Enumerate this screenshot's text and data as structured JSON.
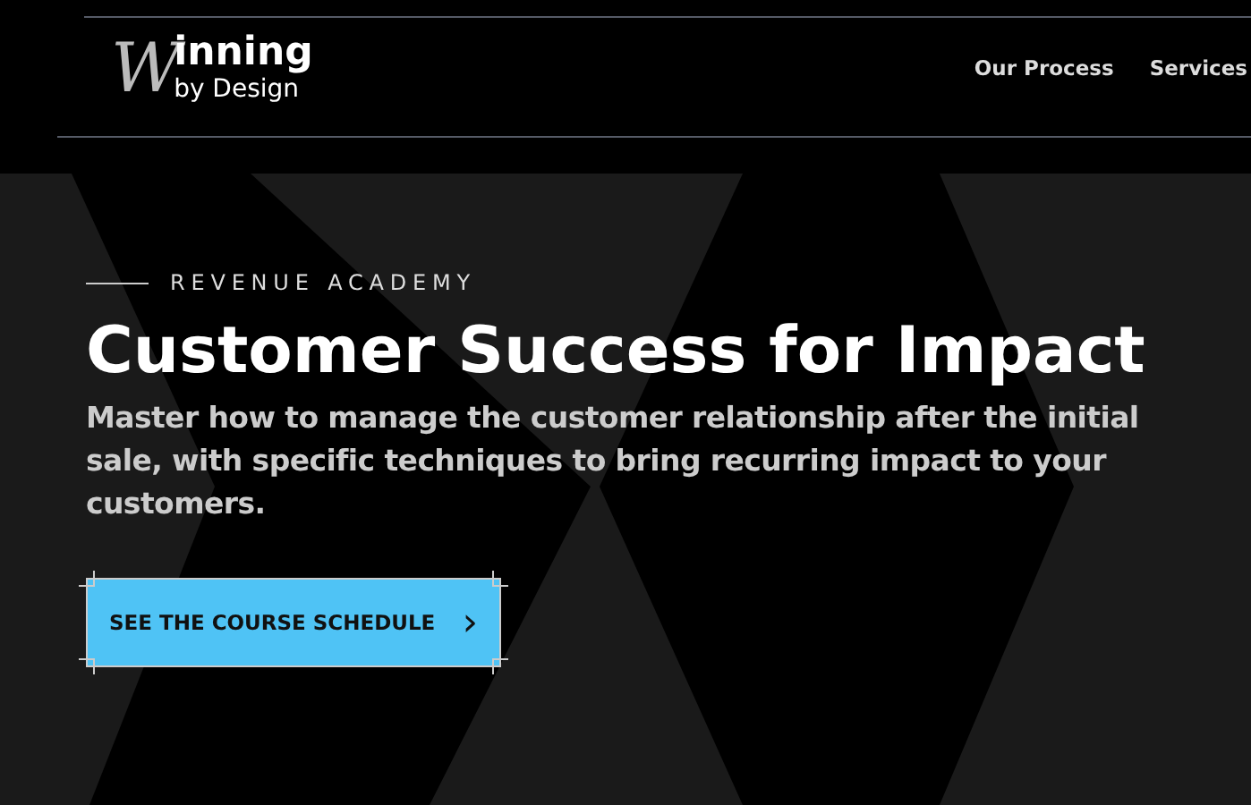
{
  "logo": {
    "mark": "W",
    "word": "inning",
    "tagline": "by Design"
  },
  "nav": [
    "Our Process",
    "Services"
  ],
  "hero": {
    "eyebrow": "REVENUE ACADEMY",
    "title": "Customer Success for Impact",
    "description": "Master how to manage the customer relationship after the initial sale, with specific techniques to bring recurring impact to your customers.",
    "cta": "SEE THE COURSE SCHEDULE",
    "cta_arrow": "›"
  }
}
